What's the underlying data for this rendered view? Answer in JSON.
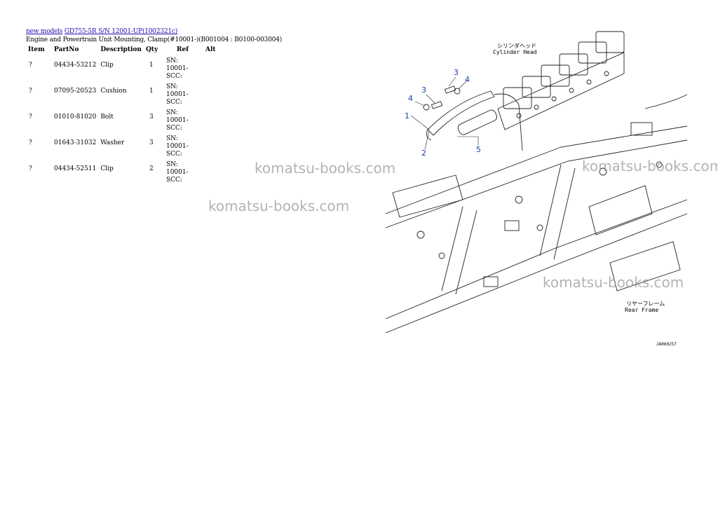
{
  "breadcrumb": {
    "link1": "new models",
    "link2": "GD755-5R S/N 12001-UP(1002321c)"
  },
  "subtitle": "Engine and Powertrain Unit Mounting, Clamp(#10001-)(B001004 : B0100-003004)",
  "table": {
    "headers": [
      "Item",
      "PartNo",
      "Description",
      "Qty",
      "Ref",
      "Alt"
    ],
    "rows": [
      {
        "item": "?",
        "part": "04434-53212",
        "desc": "Clip",
        "qty": "1",
        "ref": "SN: 10001-SCC:",
        "alt": ""
      },
      {
        "item": "?",
        "part": "07095-20523",
        "desc": "Cushion",
        "qty": "1",
        "ref": "SN: 10001-SCC:",
        "alt": ""
      },
      {
        "item": "?",
        "part": "01010-81020",
        "desc": "Bolt",
        "qty": "3",
        "ref": "SN: 10001-SCC:",
        "alt": ""
      },
      {
        "item": "?",
        "part": "01643-31032",
        "desc": "Washer",
        "qty": "3",
        "ref": "SN: 10001-SCC:",
        "alt": ""
      },
      {
        "item": "?",
        "part": "04434-52511",
        "desc": "Clip",
        "qty": "2",
        "ref": "SN: 10001-SCC:",
        "alt": ""
      }
    ]
  },
  "watermark": "komatsu-books.com",
  "diagram": {
    "cylinder_head_jp": "シリンダヘッド",
    "cylinder_head_en": "Cylinder Head",
    "rear_frame_jp": "リヤーフレーム",
    "rear_frame_en": "Rear Frame",
    "drawing_id": "JA060257",
    "callouts": [
      "1",
      "2",
      "3",
      "3",
      "4",
      "4",
      "5"
    ],
    "callout_color": "#1a3fa8"
  }
}
